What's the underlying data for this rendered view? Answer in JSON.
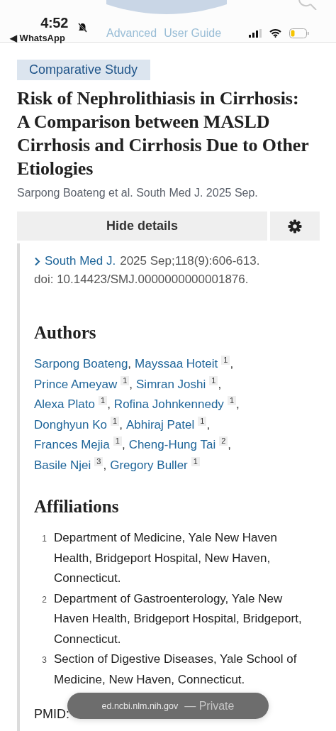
{
  "status_bar": {
    "time": "4:52",
    "back_app": "◀ WhatsApp"
  },
  "header": {
    "links": [
      "Advanced",
      "User Guide"
    ]
  },
  "article": {
    "type_tag": "Comparative Study",
    "title": "Risk of Nephrolithiasis in Cirrhosis: A Comparison between MASLD Cirrhosis and Cirrhosis Due to Other Etiologies",
    "short_citation": "Sarpong Boateng et al. South Med J. 2025 Sep.",
    "details_button": "Hide details",
    "journal": "South Med J.",
    "citation": "2025 Sep;118(9):606-613.",
    "doi": "doi: 10.14423/SMJ.0000000000001876.",
    "authors_heading": "Authors",
    "authors": [
      {
        "name": "Sarpong Boateng",
        "separator": ","
      },
      {
        "name": "Mayssaa Hoteit",
        "aff": "1",
        "separator": ","
      },
      {
        "name": "Prince Ameyaw",
        "aff": "1",
        "separator": ","
      },
      {
        "name": "Simran Joshi",
        "aff": "1",
        "separator": ","
      },
      {
        "name": "Alexa Plato",
        "aff": "1",
        "separator": ","
      },
      {
        "name": "Rofina Johnkennedy",
        "aff": "1",
        "separator": ","
      },
      {
        "name": "Donghyun Ko",
        "aff": "1",
        "separator": ","
      },
      {
        "name": "Abhiraj Patel",
        "aff": "1",
        "separator": ","
      },
      {
        "name": "Frances Mejia",
        "aff": "1",
        "separator": ","
      },
      {
        "name": "Cheng-Hung Tai",
        "aff": "2",
        "separator": ","
      },
      {
        "name": "Basile Njei",
        "aff": "3",
        "separator": ","
      },
      {
        "name": "Gregory Buller",
        "aff": "1"
      }
    ],
    "affiliations_heading": "Affiliations",
    "affiliations": [
      {
        "number": "1",
        "text": "Department of Medicine, Yale New Haven Health, Bridgeport Hospital, New Haven, Connecticut."
      },
      {
        "number": "2",
        "text": "Department of Gastroenterology, Yale New Haven Health, Bridgeport Hospital, Bridgeport, Connecticut."
      },
      {
        "number": "3",
        "text": "Section of Digestive Diseases, Yale School of Medicine, New Haven, Connecticut."
      }
    ],
    "pmid_label": "PMID:"
  },
  "address_pill": {
    "host": "ed.ncbi.nlm.nih.gov",
    "mode": "— Private"
  }
}
